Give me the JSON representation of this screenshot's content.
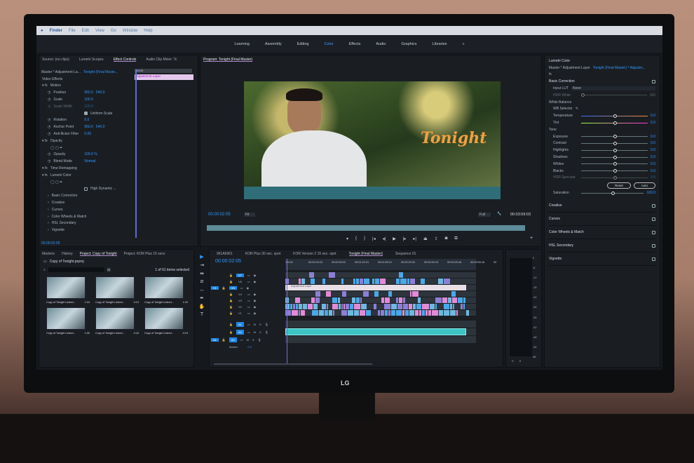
{
  "os_menu": {
    "apple": "",
    "items": [
      "Finder",
      "File",
      "Edit",
      "View",
      "Go",
      "Window",
      "Help"
    ]
  },
  "workspaces": {
    "items": [
      "Learning",
      "Assembly",
      "Editing",
      "Color",
      "Effects",
      "Audio",
      "Graphics",
      "Libraries"
    ],
    "active": "Color",
    "more": "»"
  },
  "left_panel": {
    "tabs": [
      "Source: (no clips)",
      "Lumetri Scopes",
      "Effect Controls",
      "Audio Clip Mixer: Tc"
    ],
    "active": "Effect Controls",
    "master": "Master * Adjustment La...",
    "sequence": "Tonight (Final Maste...",
    "ruler_time": "00:00",
    "clip_label": "Adjustment Layer",
    "section": "Video Effects",
    "rows": [
      {
        "label": "Motion",
        "kind": "fx"
      },
      {
        "label": "Position",
        "v1": "960.0",
        "v2": "540.0"
      },
      {
        "label": "Scale",
        "v1": "100.0"
      },
      {
        "label": "Scale Width",
        "v1": "100.0",
        "dim": true
      },
      {
        "label": "Uniform Scale",
        "kind": "check",
        "checked": true
      },
      {
        "label": "Rotation",
        "v1": "0.0"
      },
      {
        "label": "Anchor Point",
        "v1": "960.0",
        "v2": "540.0"
      },
      {
        "label": "Anti-flicker Filter",
        "v1": "0.00"
      },
      {
        "label": "Opacity",
        "kind": "fx"
      },
      {
        "label": "",
        "kind": "masks"
      },
      {
        "label": "Opacity",
        "v1": "100.0 %"
      },
      {
        "label": "Blend Mode",
        "v1": "Normal"
      },
      {
        "label": "Time Remapping",
        "kind": "fx"
      },
      {
        "label": "Lumetri Color",
        "kind": "fx"
      },
      {
        "label": "",
        "kind": "masks"
      },
      {
        "label": "High Dynamic ...",
        "kind": "check",
        "checked": false
      },
      {
        "label": "Basic Correction",
        "kind": "sub"
      },
      {
        "label": "Creative",
        "kind": "sub"
      },
      {
        "label": "Curves",
        "kind": "sub"
      },
      {
        "label": "Color Wheels & Match",
        "kind": "sub"
      },
      {
        "label": "HSL Secondary",
        "kind": "sub"
      },
      {
        "label": "Vignette",
        "kind": "sub"
      }
    ],
    "timecode": "00:00:02:05"
  },
  "program": {
    "title": "Program: Tonight (Final Master)",
    "overlay_text": "Tonight",
    "timecode": "00:00:02:05",
    "fit": "Fit",
    "quality": "Full",
    "duration": "00:03:59:03",
    "controls": [
      "marker",
      "in",
      "out",
      "go-to-in",
      "step-back",
      "play",
      "step-forward",
      "go-to-out",
      "lift",
      "extract",
      "export-frame",
      "compare"
    ]
  },
  "lumetri": {
    "title": "Lumetri Color",
    "master": "Master * Adjustment Layer",
    "sequence": "Tonight (Final Master) * Adjustm...",
    "basic": "Basic Correction",
    "input_lut_label": "Input LUT",
    "input_lut": "None",
    "hdr_white_label": "HDR White",
    "hdr_white": "100",
    "white_balance": "White Balance",
    "wb_selector": "WB Selector",
    "temperature": {
      "label": "Temperature",
      "value": "0.0"
    },
    "tint": {
      "label": "Tint",
      "value": "0.0"
    },
    "tone": "Tone",
    "tone_rows": [
      {
        "label": "Exposure",
        "value": "0.0"
      },
      {
        "label": "Contrast",
        "value": "0.0"
      },
      {
        "label": "Highlights",
        "value": "0.0"
      },
      {
        "label": "Shadows",
        "value": "0.0"
      },
      {
        "label": "Whites",
        "value": "0.0"
      },
      {
        "label": "Blacks",
        "value": "0.0"
      },
      {
        "label": "HDR Specular",
        "value": "0.0"
      }
    ],
    "reset": "Reset",
    "auto": "Auto",
    "saturation": {
      "label": "Saturation",
      "value": "100.0"
    },
    "sections": [
      "Creative",
      "Curves",
      "Color Wheels & Match",
      "HSL Secondary",
      "Vignette"
    ]
  },
  "project": {
    "tabs": [
      "Markers",
      "History",
      "Project: Copy of Tonight",
      "Project: KOR Plus 15 secs"
    ],
    "active": "Project: Copy of Tonight",
    "file": "Copy of Tonight.prproj",
    "selection": "1 of 61 items selected",
    "items": [
      {
        "name": "Copy of Tonight Linked...",
        "dur": "1:04"
      },
      {
        "name": "Copy of Tonight Linked...",
        "dur": "0:19"
      },
      {
        "name": "Copy of Tonight Linked...",
        "dur": "1:22"
      },
      {
        "name": "Copy of Tonight Linked...",
        "dur": "1:00"
      },
      {
        "name": "Copy of Tonight Linked...",
        "dur": "0:16"
      },
      {
        "name": "Copy of Tonight Linked...",
        "dur": "0:19"
      }
    ]
  },
  "timeline": {
    "tabs": [
      "961A6961",
      "KOR Plus 30 sec. spot",
      "KOR Version 2 15 sec. spot",
      "Tonight (Final Master)",
      "Sequence 01"
    ],
    "active": "Tonight (Final Master)",
    "timecode": "00:00:02:05",
    "ruler": [
      ":00:00",
      "00:00:29:23",
      "00:00:59:22",
      "00:01:29:21",
      "00:01:59:21",
      "00:02:29:20",
      "00:02:59:19",
      "00:03:29:18",
      "00:03:59:18",
      "00"
    ],
    "video_tracks": [
      "V7",
      "V6",
      "V5",
      "V4",
      "V3",
      "V2",
      "V1"
    ],
    "audio_tracks": [
      "A1",
      "A2",
      "A3"
    ],
    "source_v": "V1",
    "source_a": "A1",
    "master_label": "Master",
    "master_value": "0.0",
    "adjustment_clip": "Adjustment Layer",
    "mute": "M",
    "solo": "S"
  },
  "meters": {
    "scale": [
      "0",
      "-6",
      "-12",
      "-18",
      "-24",
      "-30",
      "-36",
      "-42",
      "-48",
      "-54",
      "dB"
    ],
    "solo": [
      "S",
      "S"
    ]
  },
  "brand": {
    "logo": "LG"
  },
  "colors": {
    "accent": "#2f97ff",
    "title_orange": "#f0a040",
    "clip_blue": "#4aa8e8",
    "clip_purple": "#8c7fd6",
    "clip_pink": "#e28ad8",
    "audio": "#3fc4c4"
  }
}
